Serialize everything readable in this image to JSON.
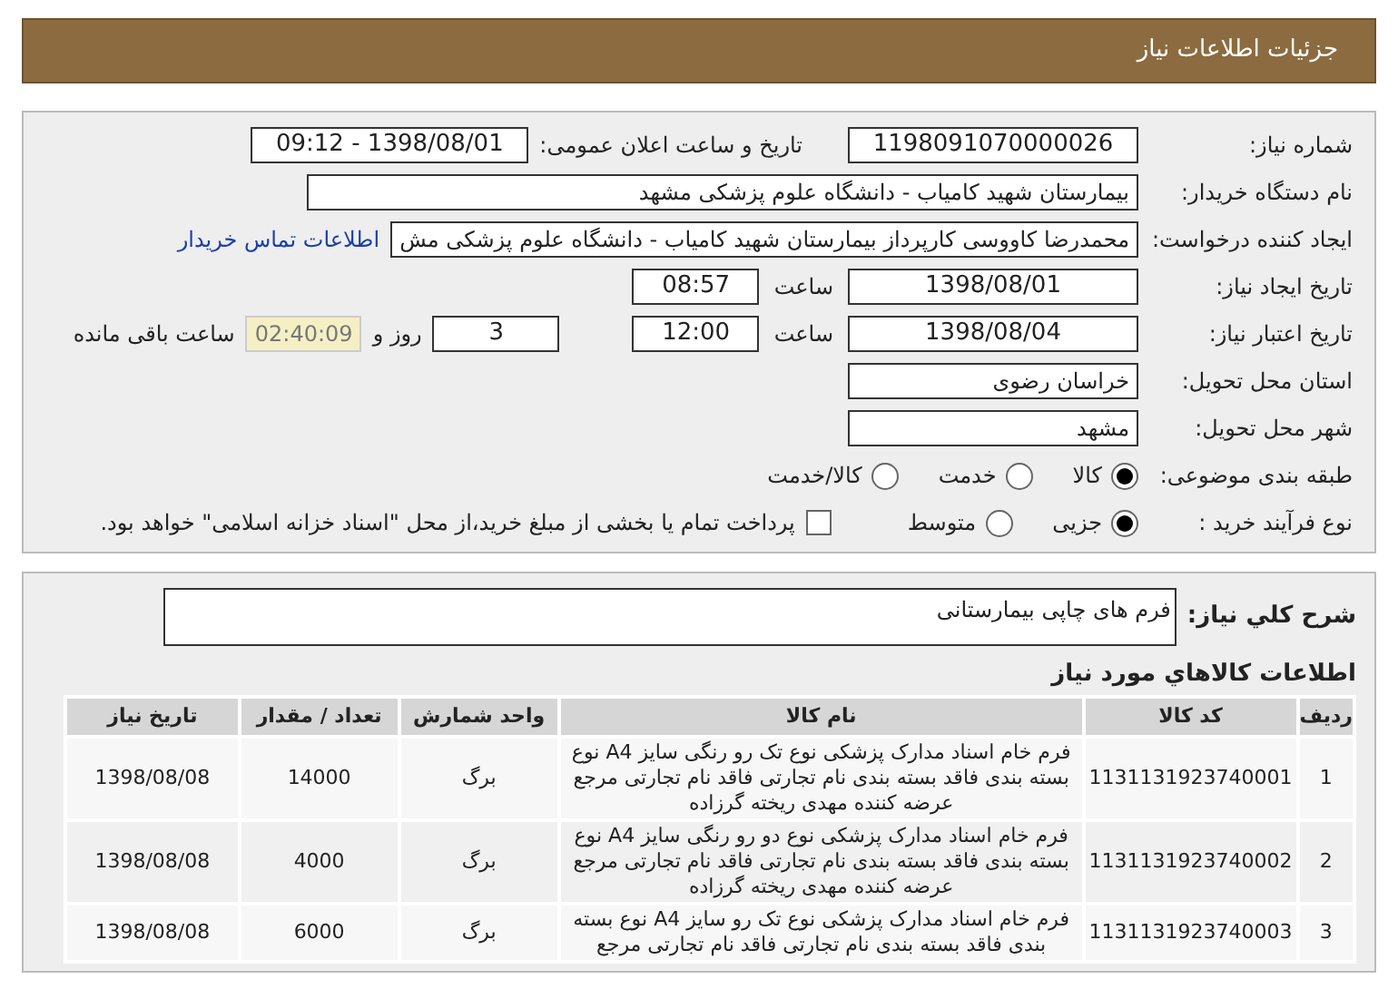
{
  "header": {
    "title": "جزئیات اطلاعات نیاز"
  },
  "details": {
    "need_number": {
      "label": "شماره نیاز:",
      "value": "1198091070000026"
    },
    "announce": {
      "label": "تاریخ و ساعت اعلان عمومی:",
      "value": "1398/08/01 - 09:12"
    },
    "buyer": {
      "label": "نام دستگاه خریدار:",
      "value": "بیمارستان شهید کامیاب - دانشگاه علوم پزشکی مشهد"
    },
    "creator": {
      "label": "ایجاد کننده درخواست:",
      "value": "محمدرضا کاووسی کارپرداز بیمارستان شهید کامیاب - دانشگاه علوم پزشکی مش",
      "link": "اطلاعات تماس خریدار"
    },
    "created": {
      "label": "تاریخ ایجاد نیاز:",
      "date": "1398/08/01",
      "time_label": "ساعت",
      "time": "08:57"
    },
    "validity": {
      "label": "تاریخ اعتبار نیاز:",
      "date": "1398/08/04",
      "time_label": "ساعت",
      "time": "12:00",
      "days": "3",
      "days_label": "روز و",
      "remaining": "02:40:09",
      "remaining_label": "ساعت باقی مانده"
    },
    "province": {
      "label": "استان محل تحویل:",
      "value": "خراسان رضوی"
    },
    "city": {
      "label": "شهر محل تحویل:",
      "value": "مشهد"
    },
    "category": {
      "label": "طبقه بندی موضوعی:",
      "options": [
        {
          "label": "کالا",
          "selected": true
        },
        {
          "label": "خدمت",
          "selected": false
        },
        {
          "label": "کالا/خدمت",
          "selected": false
        }
      ]
    },
    "purchase_type": {
      "label": "نوع فرآیند خرید :",
      "options": [
        {
          "label": "جزیی",
          "selected": true
        },
        {
          "label": "متوسط",
          "selected": false
        }
      ],
      "payment": {
        "checked": false,
        "text": "پرداخت تمام یا بخشی از مبلغ خرید،از محل \"اسناد خزانه اسلامی\" خواهد بود."
      }
    }
  },
  "description": {
    "label": "شرح کلي نياز:",
    "value": "فرم های چاپی بیمارستانی"
  },
  "items": {
    "title": "اطلاعات کالاهاي مورد نياز",
    "columns": [
      "ردیف",
      "کد کالا",
      "نام کالا",
      "واحد شمارش",
      "تعداد / مقدار",
      "تاریخ نیاز"
    ],
    "rows": [
      [
        "1",
        "1131131923740001",
        "فرم خام اسناد مدارک پزشکی نوع تک رو رنگی سایز A4 نوع بسته بندی فاقد بسته بندی نام تجارتی فاقد نام تجارتی مرجع عرضه کننده مهدی ریخته گرزاده",
        "برگ",
        "14000",
        "1398/08/08"
      ],
      [
        "2",
        "1131131923740002",
        "فرم خام اسناد مدارک پزشکی نوع دو رو رنگی سایز A4 نوع بسته بندی فاقد بسته بندی نام تجارتی فاقد نام تجارتی مرجع عرضه کننده مهدی ریخته گرزاده",
        "برگ",
        "4000",
        "1398/08/08"
      ],
      [
        "3",
        "1131131923740003",
        "فرم خام اسناد مدارک پزشکی نوع تک رو سایز A4 نوع بسته بندی فاقد بسته بندی نام تجارتی فاقد نام تجارتی مرجع",
        "برگ",
        "6000",
        "1398/08/08"
      ]
    ]
  }
}
